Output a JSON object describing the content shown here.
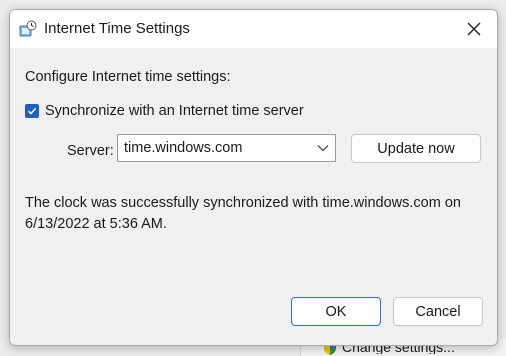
{
  "dialog": {
    "title": "Internet Time Settings",
    "heading": "Configure Internet time settings:",
    "sync_checkbox": {
      "label": "Synchronize with an Internet time server",
      "checked": true
    },
    "server": {
      "label": "Server:",
      "value": "time.windows.com"
    },
    "update_button": "Update now",
    "status_line1": "The clock was successfully synchronized with time.windows.com on",
    "status_line2": "6/13/2022 at 5:36 AM.",
    "ok_button": "OK",
    "cancel_button": "Cancel"
  },
  "background": {
    "change_settings_label": "Change settings..."
  },
  "colors": {
    "accent": "#1f5fbf",
    "ok_border": "#2f6fc8"
  },
  "icons": {
    "title": "clock-globe-icon",
    "close": "close-icon",
    "checkbox": "checkmark-icon",
    "dropdown": "chevron-down-icon",
    "shield": "uac-shield-icon"
  }
}
